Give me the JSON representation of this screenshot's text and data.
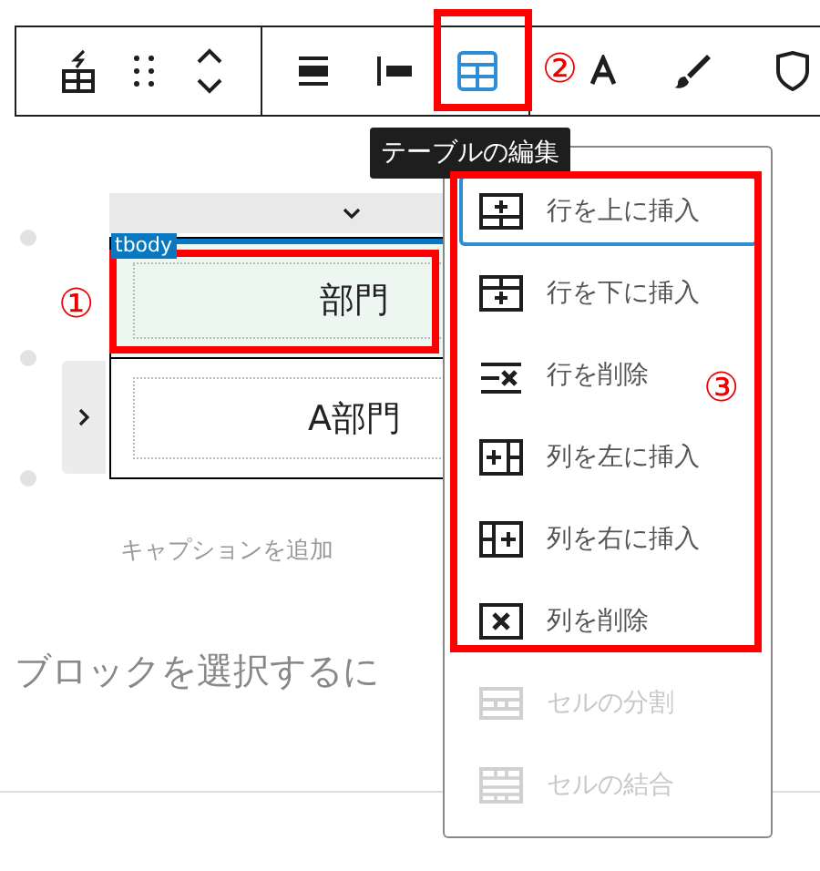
{
  "toolbar": {
    "table_edit_active": true
  },
  "tooltip": "テーブルの編集",
  "table": {
    "section_label": "tbody",
    "rows": [
      {
        "cells": [
          {
            "text": "部門",
            "selected": true
          }
        ]
      },
      {
        "cells": [
          {
            "text": "A部門",
            "selected": false
          }
        ]
      }
    ]
  },
  "caption_placeholder": "キャプションを追加",
  "hint": "ブロックを選択するに",
  "menu": {
    "items": [
      {
        "kind": "row-above",
        "label": "行を上に挿入",
        "selected": true,
        "disabled": false
      },
      {
        "kind": "row-below",
        "label": "行を下に挿入",
        "selected": false,
        "disabled": false
      },
      {
        "kind": "row-delete",
        "label": "行を削除",
        "selected": false,
        "disabled": false
      },
      {
        "kind": "col-left",
        "label": "列を左に挿入",
        "selected": false,
        "disabled": false
      },
      {
        "kind": "col-right",
        "label": "列を右に挿入",
        "selected": false,
        "disabled": false
      },
      {
        "kind": "col-delete",
        "label": "列を削除",
        "selected": false,
        "disabled": false
      },
      {
        "kind": "split",
        "label": "セルの分割",
        "selected": false,
        "disabled": true
      },
      {
        "kind": "merge",
        "label": "セルの結合",
        "selected": false,
        "disabled": true
      }
    ]
  },
  "annotations": [
    {
      "label": "①"
    },
    {
      "label": "②"
    },
    {
      "label": "③"
    }
  ]
}
